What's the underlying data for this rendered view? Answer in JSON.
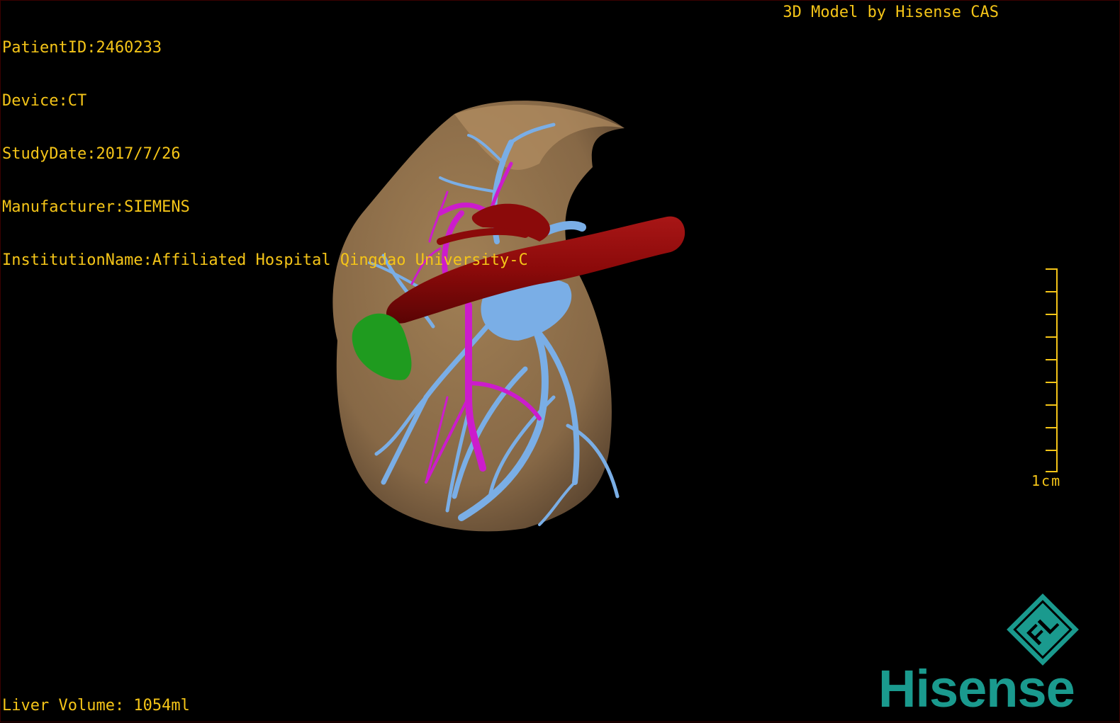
{
  "patient": {
    "id_line": "PatientID:2460233",
    "device_line": "Device:CT",
    "study_date_line": "StudyDate:2017/7/26",
    "manufacturer_line": "Manufacturer:SIEMENS",
    "institution_line": "InstitutionName:Affiliated Hospital Qingdao University-C"
  },
  "header": {
    "model_credit": "3D Model by Hisense CAS"
  },
  "footer": {
    "liver_volume": "Liver Volume: 1054ml"
  },
  "scale_bar": {
    "label": "1cm",
    "color": "#f5c518"
  },
  "branding": {
    "logo_letters": "FL",
    "brand_name": "Hisense",
    "brand_color": "#1a9a8e"
  },
  "colors": {
    "liver": "#9c7a52",
    "portal_vein": "#7aaee6",
    "hepatic_artery": "#cc1ccc",
    "vena_cava": "#8b0a0a",
    "lesion": "#1f9b1f",
    "text": "#f5c518"
  }
}
